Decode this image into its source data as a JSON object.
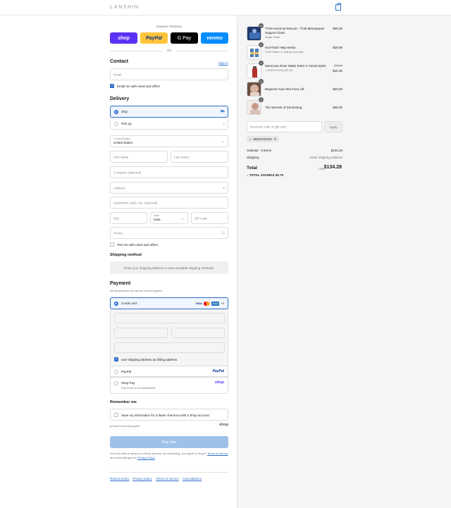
{
  "brand": {
    "logo": "LANSHIN"
  },
  "express": {
    "label": "Express checkout",
    "buttons": {
      "shop": "shop",
      "paypal": "PayPal",
      "gpay": "G Pay",
      "venmo": "venmo"
    },
    "or": "OR"
  },
  "contact": {
    "heading": "Contact",
    "sign_in": "Sign in",
    "email_placeholder": "Email",
    "news_label": "Email me with news and offers"
  },
  "delivery": {
    "heading": "Delivery",
    "options": {
      "ship": "Ship",
      "pickup": "Pick up"
    },
    "country_label": "Country/Region",
    "country_value": "United States",
    "first_name": "First name",
    "last_name": "Last name",
    "company": "Company (optional)",
    "address": "Address",
    "apartment": "Apartment, suite, etc. (optional)",
    "city": "City",
    "state_label": "State",
    "state_value": "Iowa",
    "zip": "ZIP code",
    "phone": "Phone",
    "text_news": "Text me with news and offers"
  },
  "shipping": {
    "heading": "Shipping method",
    "message": "Enter your shipping address to view available shipping methods."
  },
  "payment": {
    "heading": "Payment",
    "subtitle": "All transactions are secure and encrypted.",
    "credit_card": "Credit card",
    "brands": {
      "visa": "VISA",
      "amex": "AMEX",
      "more": "+3"
    },
    "use_shipping": "Use shipping address as billing address",
    "paypal": "PayPal",
    "paypal_logo": "PayPal",
    "shoppay": "Shop Pay",
    "shoppay_sub": "Pay in full or in installments",
    "shoppay_logo": "shop"
  },
  "remember": {
    "heading": "Remember me",
    "label": "Save my information for a faster checkout with a Shop account",
    "secure": "Secure and encrypted",
    "shop": "shop"
  },
  "pay_now": "Pay now",
  "legal": {
    "prefix": "Your info will be saved to a Shop account. By continuing, you agree to Shop's",
    "terms": "Terms of Service",
    "mid": "and acknowledge the",
    "privacy": "Privacy Policy",
    "end": "."
  },
  "footer": [
    "Refund policy",
    "Privacy policy",
    "Terms of service",
    "Cancellations"
  ],
  "cart": {
    "items": [
      {
        "qty": "1",
        "name": "TCM Insomnia Rescue - TCM Menopause Support Class",
        "sub": "Single Class",
        "price": "$35.00",
        "old": ""
      },
      {
        "qty": "1",
        "name": "Hot Flash Help Herba",
        "sub": "TCM Pattern 1: Kidney Dry Heat",
        "price": "$28.98",
        "old": ""
      },
      {
        "qty": "1",
        "name": "Moroccan Rose Water Estm C Facial Spritz",
        "sub": "MISSYOU15 (-$2.70)",
        "price": "$15.30",
        "old": "$18.00"
      },
      {
        "qty": "1",
        "name": "Beginner Gua Sha Face Lift",
        "sub": "",
        "price": "$20.00",
        "old": ""
      },
      {
        "qty": "1",
        "name": "The Secrets of Strumming",
        "sub": "",
        "price": "$35.00",
        "old": ""
      }
    ],
    "discount_placeholder": "Discount code or gift card",
    "apply": "Apply",
    "code": "MISSYOU15",
    "subtotal_label": "Subtotal · 5 items",
    "subtotal": "$134.28",
    "shipping_label": "Shipping",
    "shipping_value": "Enter shipping address",
    "total_label": "Total",
    "currency": "USD",
    "total": "$134.28",
    "savings_label": "TOTAL SAVINGS",
    "savings": "$2.70"
  },
  "colors": {
    "accent": "#2c6ecb",
    "shop": "#5a31f4",
    "paypal": "#ffc439",
    "venmo": "#008cff",
    "pay_button": "#9dc1e8"
  }
}
